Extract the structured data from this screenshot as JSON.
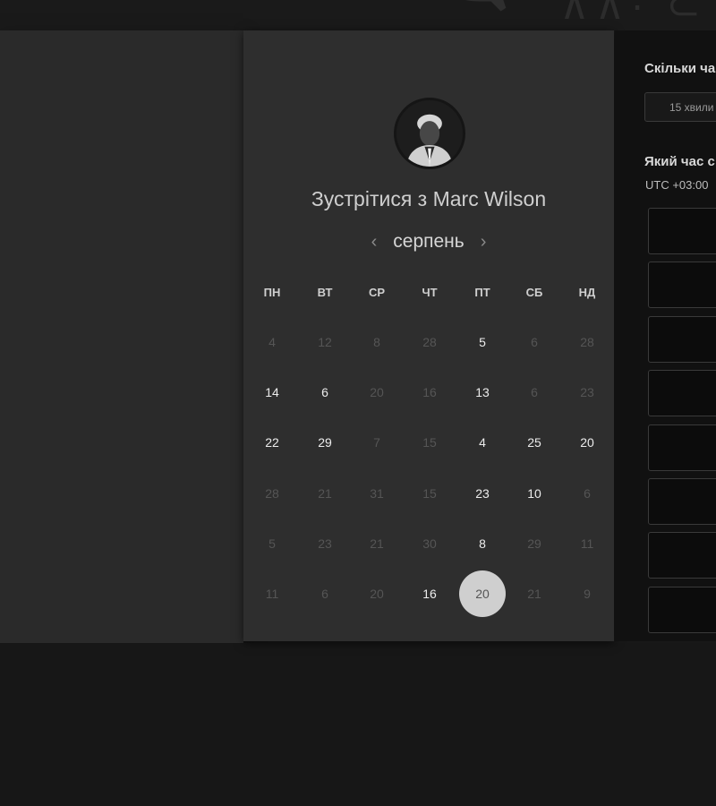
{
  "header": {
    "logo_icon": "speech-bubble-logo-icon"
  },
  "calendar": {
    "host_avatar": "avatar-icon",
    "title_prefix": "Зустрітися з",
    "host_name": "Marc Wilson",
    "month": "серпень",
    "prev_icon": "chevron-left-icon",
    "next_icon": "chevron-right-icon",
    "weekdays": [
      "ПН",
      "ВТ",
      "СР",
      "ЧТ",
      "ПТ",
      "СБ",
      "НД"
    ],
    "weeks": [
      [
        {
          "d": "4",
          "a": false
        },
        {
          "d": "12",
          "a": false
        },
        {
          "d": "8",
          "a": false
        },
        {
          "d": "28",
          "a": false
        },
        {
          "d": "5",
          "a": true
        },
        {
          "d": "6",
          "a": false
        },
        {
          "d": "28",
          "a": false
        }
      ],
      [
        {
          "d": "14",
          "a": true
        },
        {
          "d": "6",
          "a": true
        },
        {
          "d": "20",
          "a": false
        },
        {
          "d": "16",
          "a": false
        },
        {
          "d": "13",
          "a": true
        },
        {
          "d": "6",
          "a": false
        },
        {
          "d": "23",
          "a": false
        }
      ],
      [
        {
          "d": "22",
          "a": true
        },
        {
          "d": "29",
          "a": true
        },
        {
          "d": "7",
          "a": false
        },
        {
          "d": "15",
          "a": false
        },
        {
          "d": "4",
          "a": true
        },
        {
          "d": "25",
          "a": true
        },
        {
          "d": "20",
          "a": true
        }
      ],
      [
        {
          "d": "28",
          "a": false
        },
        {
          "d": "21",
          "a": false
        },
        {
          "d": "31",
          "a": false
        },
        {
          "d": "15",
          "a": false
        },
        {
          "d": "23",
          "a": true
        },
        {
          "d": "10",
          "a": true
        },
        {
          "d": "6",
          "a": false
        }
      ],
      [
        {
          "d": "5",
          "a": false
        },
        {
          "d": "23",
          "a": false
        },
        {
          "d": "21",
          "a": false
        },
        {
          "d": "30",
          "a": false
        },
        {
          "d": "8",
          "a": true
        },
        {
          "d": "29",
          "a": false
        },
        {
          "d": "11",
          "a": false
        }
      ],
      [
        {
          "d": "11",
          "a": false
        },
        {
          "d": "6",
          "a": false
        },
        {
          "d": "20",
          "a": false
        },
        {
          "d": "16",
          "a": true
        },
        {
          "d": "20",
          "a": true,
          "selected": true
        },
        {
          "d": "21",
          "a": false
        },
        {
          "d": "9",
          "a": false
        }
      ]
    ]
  },
  "booking": {
    "duration_label": "Скільки ча",
    "duration_value": "15 хвили",
    "time_label": "Який час с",
    "timezone": "UTC +03:00",
    "slot_count": 8
  }
}
